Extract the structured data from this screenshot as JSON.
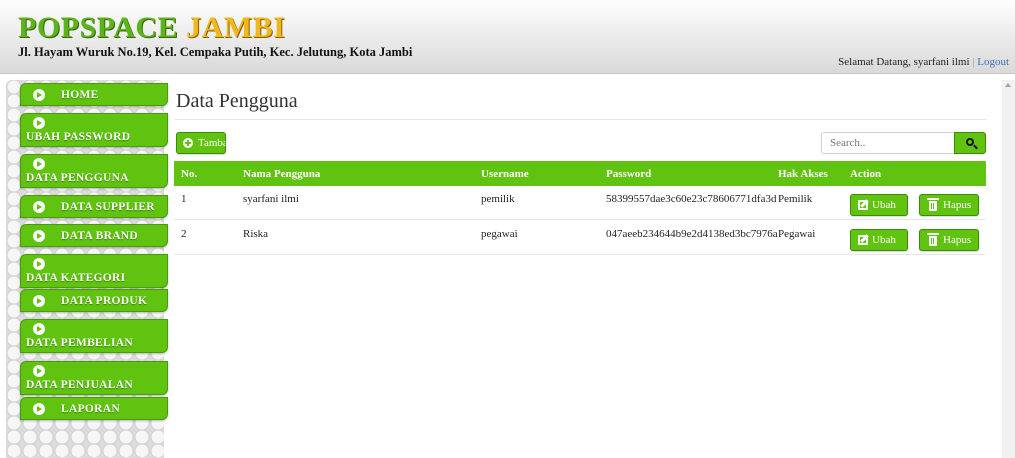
{
  "header": {
    "brand_part1": "POPSPACE",
    "brand_part2": "JAMBI",
    "address": "Jl. Hayam Wuruk No.19, Kel. Cempaka Putih, Kec. Jelutung, Kota Jambi",
    "welcome_text": "Selamat Datang, syarfani ilmi",
    "separator": "|",
    "logout_label": "Logout"
  },
  "sidebar": {
    "items": [
      {
        "label": "HOME"
      },
      {
        "label": "UBAH PASSWORD"
      },
      {
        "label": "DATA PENGGUNA"
      },
      {
        "label": "DATA SUPPLIER"
      },
      {
        "label": "DATA BRAND"
      },
      {
        "label": "DATA KATEGORI"
      },
      {
        "label": "DATA PRODUK"
      },
      {
        "label": "DATA PEMBELIAN"
      },
      {
        "label": "DATA PENJUALAN"
      },
      {
        "label": "LAPORAN"
      }
    ]
  },
  "main": {
    "title": "Data Pengguna",
    "add_label": "Tambah",
    "search_placeholder": "Search.."
  },
  "table": {
    "headers": [
      "No.",
      "Nama Pengguna",
      "Username",
      "Password",
      "Hak Akses",
      "Action"
    ],
    "rows": [
      {
        "no": "1",
        "nama": "syarfani ilmi",
        "username": "pemilik",
        "password": "58399557dae3c60e23c78606771dfa3d",
        "hak": "Pemilik"
      },
      {
        "no": "2",
        "nama": "Riska",
        "username": "pegawai",
        "password": "047aeeb234644b9e2d4138ed3bc7976a",
        "hak": "Pegawai"
      }
    ],
    "edit_label": "Ubah",
    "delete_label": "Hapus"
  },
  "colors": {
    "accent_green": "#5fc30f",
    "brand_green": "#5cb31a",
    "brand_yellow": "#f0b81c"
  }
}
